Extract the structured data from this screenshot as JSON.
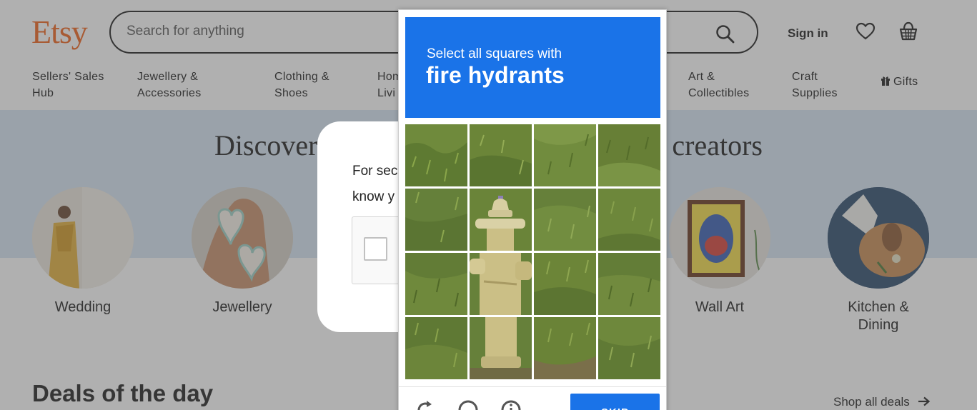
{
  "header": {
    "logo": "Etsy",
    "search_placeholder": "Search for anything",
    "signin_label": "Sign in"
  },
  "nav": {
    "items": [
      {
        "line1": "Sellers' Sales",
        "line2": "Hub"
      },
      {
        "line1": "Jewellery &",
        "line2": "Accessories"
      },
      {
        "line1": "Clothing &",
        "line2": "Shoes"
      },
      {
        "line1": "Hom",
        "line2": "Livi"
      },
      {
        "line1": "Art &",
        "line2": "Collectibles"
      },
      {
        "line1": "Craft",
        "line2": "Supplies"
      }
    ],
    "gifts_label": "Gifts"
  },
  "hero": {
    "title_left": "Discover one-o",
    "title_right": "dent creators",
    "categories": [
      {
        "label": "Wedding"
      },
      {
        "label": "Jewellery"
      },
      {
        "label": "Wall Art"
      },
      {
        "label": "Kitchen &",
        "label2": "Dining"
      }
    ]
  },
  "deals": {
    "title": "Deals of the day",
    "shop_all": "Shop all deals"
  },
  "dialog": {
    "line1": "For sec",
    "line2": "know y"
  },
  "captcha": {
    "instruction": "Select all squares with",
    "target": "fire hydrants",
    "skip_label": "SKIP"
  },
  "colors": {
    "etsy_orange": "#F1641E",
    "captcha_blue": "#1A73E8",
    "hero_bg": "#D7E6F5"
  }
}
